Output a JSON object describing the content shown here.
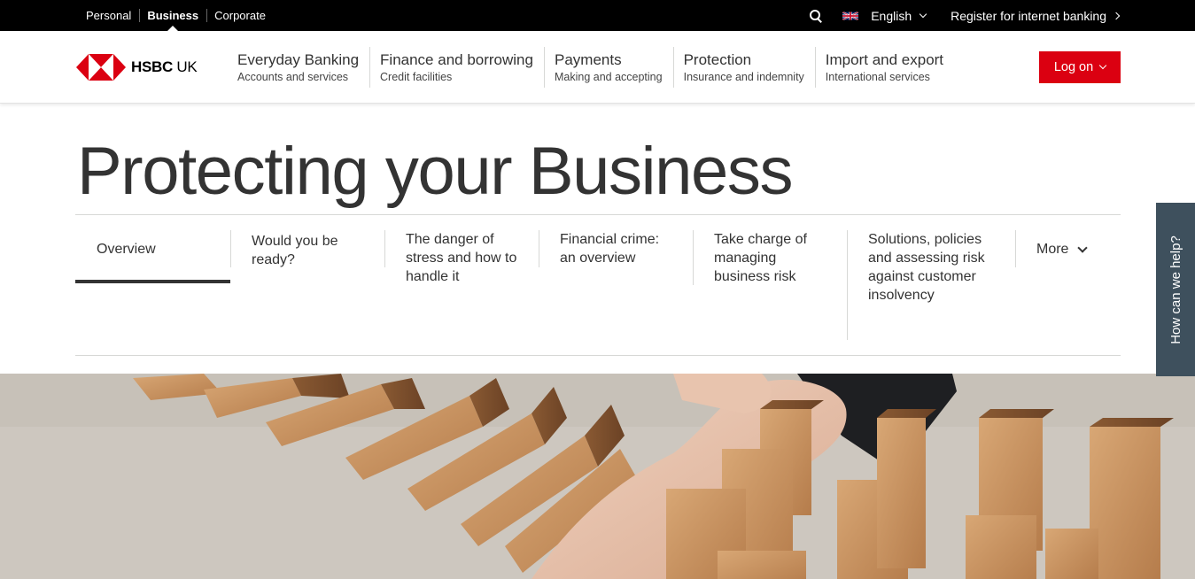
{
  "topbar": {
    "segments": [
      "Personal",
      "Business",
      "Corporate"
    ],
    "active_segment": "Business",
    "language": "English",
    "register_label": "Register for internet banking"
  },
  "brand": {
    "name_bold": "HSBC",
    "name_suffix": " UK",
    "red": "#db0011",
    "black": "#000000"
  },
  "nav": [
    {
      "title": "Everyday Banking",
      "sub": "Accounts and services"
    },
    {
      "title": "Finance and borrowing",
      "sub": "Credit facilities"
    },
    {
      "title": "Payments",
      "sub": "Making and accepting"
    },
    {
      "title": "Protection",
      "sub": "Insurance and indemnity"
    },
    {
      "title": "Import and export",
      "sub": "International services"
    }
  ],
  "logon_label": "Log on",
  "page_title": "Protecting your Business",
  "subtabs": [
    "Overview",
    "Would you be ready?",
    "The danger of stress and how to handle it",
    "Financial crime: an overview",
    "Take charge of managing business risk",
    "Solutions, policies and assessing risk against customer insolvency",
    "More"
  ],
  "help_label": "How can we help?",
  "icons": [
    "search-icon",
    "uk-flag-icon",
    "chevron-down-icon",
    "chevron-right-icon",
    "hsbc-hexagon-logo"
  ]
}
